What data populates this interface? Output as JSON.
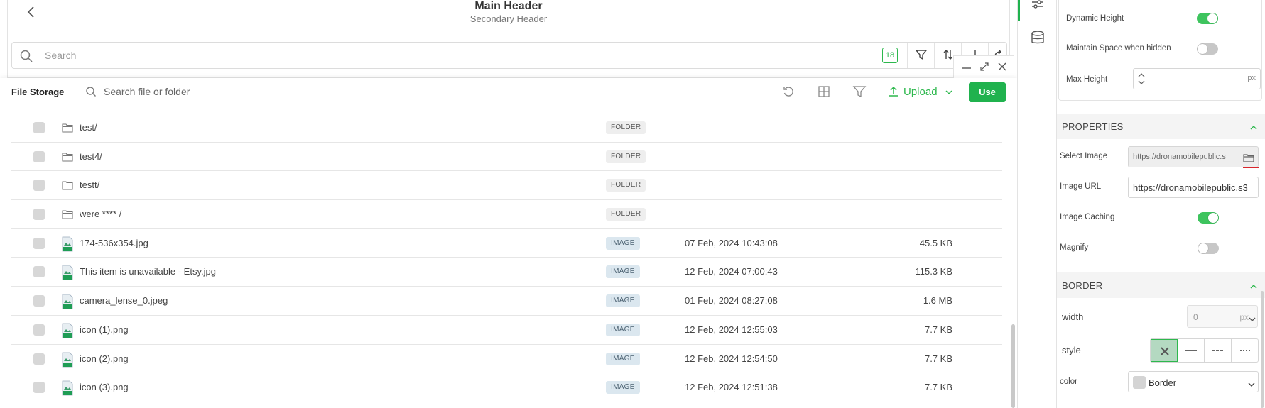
{
  "app": {
    "main_header": "Main Header",
    "secondary_header": "Secondary Header",
    "search_placeholder": "Search",
    "result_count": "18"
  },
  "file_storage": {
    "title": "File Storage",
    "search_placeholder": "Search file or folder",
    "upload_label": "Upload",
    "use_label": "Use",
    "rows": [
      {
        "name": "test/",
        "kind": "folder",
        "tag": "FOLDER",
        "date": "",
        "size": ""
      },
      {
        "name": "test4/",
        "kind": "folder",
        "tag": "FOLDER",
        "date": "",
        "size": ""
      },
      {
        "name": "testt/",
        "kind": "folder",
        "tag": "FOLDER",
        "date": "",
        "size": ""
      },
      {
        "name": "were **** /",
        "kind": "folder",
        "tag": "FOLDER",
        "date": "",
        "size": ""
      },
      {
        "name": "174-536x354.jpg",
        "kind": "image",
        "tag": "IMAGE",
        "date": "07 Feb, 2024 10:43:08",
        "size": "45.5 KB"
      },
      {
        "name": "This item is unavailable - Etsy.jpg",
        "kind": "image",
        "tag": "IMAGE",
        "date": "12 Feb, 2024 07:00:43",
        "size": "115.3 KB"
      },
      {
        "name": "camera_lense_0.jpeg",
        "kind": "image",
        "tag": "IMAGE",
        "date": "01 Feb, 2024 08:27:08",
        "size": "1.6 MB"
      },
      {
        "name": "icon (1).png",
        "kind": "image",
        "tag": "IMAGE",
        "date": "12 Feb, 2024 12:55:03",
        "size": "7.7 KB"
      },
      {
        "name": "icon (2).png",
        "kind": "image",
        "tag": "IMAGE",
        "date": "12 Feb, 2024 12:54:50",
        "size": "7.7 KB"
      },
      {
        "name": "icon (3).png",
        "kind": "image",
        "tag": "IMAGE",
        "date": "12 Feb, 2024 12:51:38",
        "size": "7.7 KB"
      }
    ]
  },
  "properties_panel": {
    "dynamic_height_label": "Dynamic Height",
    "dynamic_height_on": true,
    "maintain_space_label": "Maintain Space when hidden",
    "maintain_space_on": false,
    "max_height_label": "Max Height",
    "max_height_value": "",
    "max_height_unit": "px",
    "properties_header": "PROPERTIES",
    "select_image_label": "Select Image",
    "select_image_value": "https://dronamobilepublic.s",
    "image_url_label": "Image URL",
    "image_url_value": "https://dronamobilepublic.s3",
    "image_caching_label": "Image Caching",
    "image_caching_on": true,
    "magnify_label": "Magnify",
    "magnify_on": false,
    "border_header": "BORDER",
    "width_label": "width",
    "width_value": "0",
    "width_unit": "px",
    "style_label": "style",
    "color_label": "color",
    "color_value": "Border"
  },
  "colors": {
    "accent": "#20b24e",
    "toggle_on": "#3ec45e",
    "image_tag_bg": "#dbe7ef",
    "folder_tag_bg": "#eeeeee"
  }
}
